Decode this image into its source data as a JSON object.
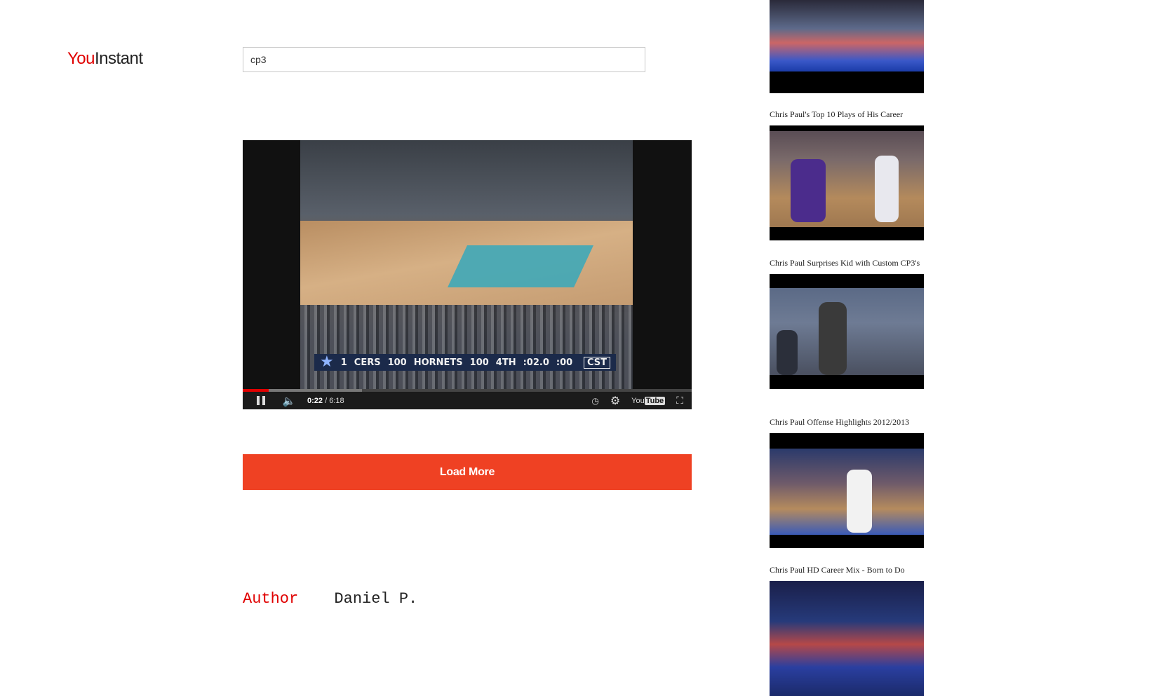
{
  "header": {
    "logo_part1": "You",
    "logo_part2": "Instant"
  },
  "search": {
    "value": "cp3"
  },
  "player": {
    "scorebug": {
      "star_number": "1",
      "team1": "CERS",
      "score1": "100",
      "team2": "HORNETS",
      "score2": "100",
      "period": "4TH",
      "clock": ":02.0",
      "shot_clock": ":00",
      "network": "CST"
    },
    "current_time": "0:22",
    "duration": "/ 6:18",
    "played_fraction": 0.058,
    "buffered_fraction": 0.266,
    "brand": "You",
    "brand_box": "Tube"
  },
  "load_more_label": "Load More",
  "author": {
    "label": "Author",
    "name": "Daniel P."
  },
  "sidebar": {
    "items": [
      {
        "title": "",
        "icon": "video-thumbnail"
      },
      {
        "title": "Chris Paul's Top 10 Plays of His Career",
        "icon": "video-thumbnail"
      },
      {
        "title": "Chris Paul Surprises Kid with Custom CP3's",
        "icon": "video-thumbnail"
      },
      {
        "title": "Chris Paul Offense Highlights 2012/2013",
        "icon": "video-thumbnail"
      },
      {
        "title": "Chris Paul HD Career Mix - Born to Do",
        "icon": "video-thumbnail"
      }
    ]
  },
  "colors": {
    "accent_red": "#e00000",
    "button_orange": "#ef4123",
    "player_bg": "#111111"
  }
}
